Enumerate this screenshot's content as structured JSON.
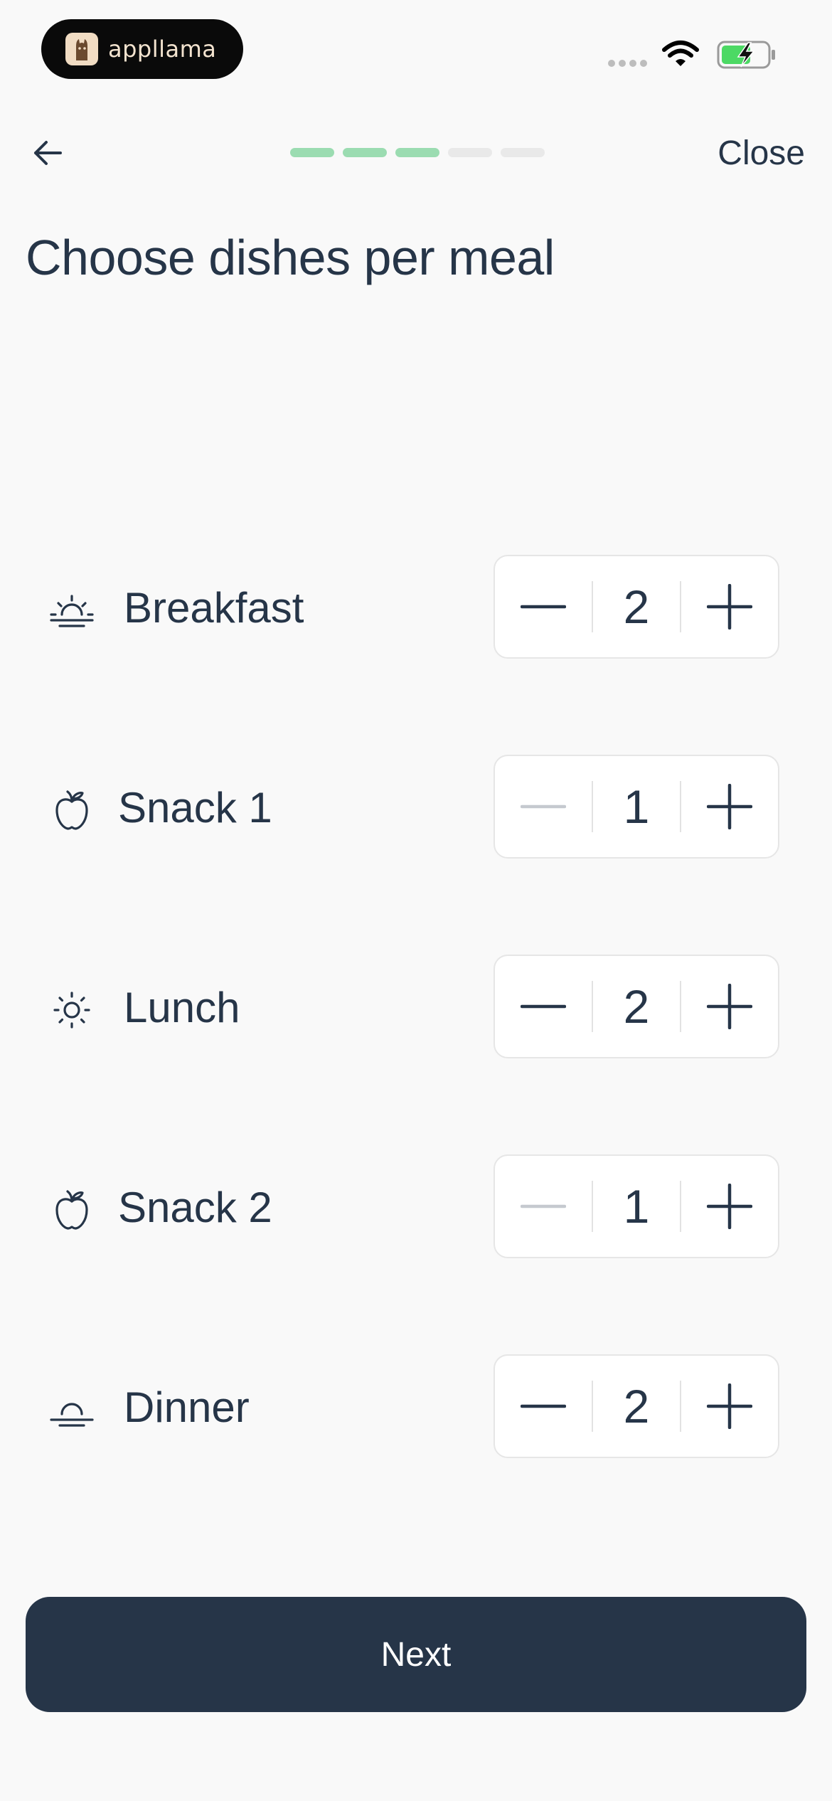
{
  "status_bar": {
    "app_name": "appllama"
  },
  "nav": {
    "close_label": "Close",
    "progress": {
      "total_steps": 5,
      "completed_steps": 3
    }
  },
  "title": "Choose dishes per meal",
  "meals": [
    {
      "label": "Breakfast",
      "value": "2",
      "icon": "sunrise-icon",
      "minus_enabled": true
    },
    {
      "label": "Snack 1",
      "value": "1",
      "icon": "apple-icon",
      "minus_enabled": false
    },
    {
      "label": "Lunch",
      "value": "2",
      "icon": "sun-icon",
      "minus_enabled": true
    },
    {
      "label": "Snack 2",
      "value": "1",
      "icon": "apple-icon",
      "minus_enabled": false
    },
    {
      "label": "Dinner",
      "value": "2",
      "icon": "sunset-icon",
      "minus_enabled": true
    }
  ],
  "next_label": "Next",
  "colors": {
    "primary": "#263548",
    "progress_done": "#9bdcb1",
    "progress_todo": "#e9e9e9",
    "disabled": "#c5c9cf",
    "background": "#f9f9f9"
  }
}
